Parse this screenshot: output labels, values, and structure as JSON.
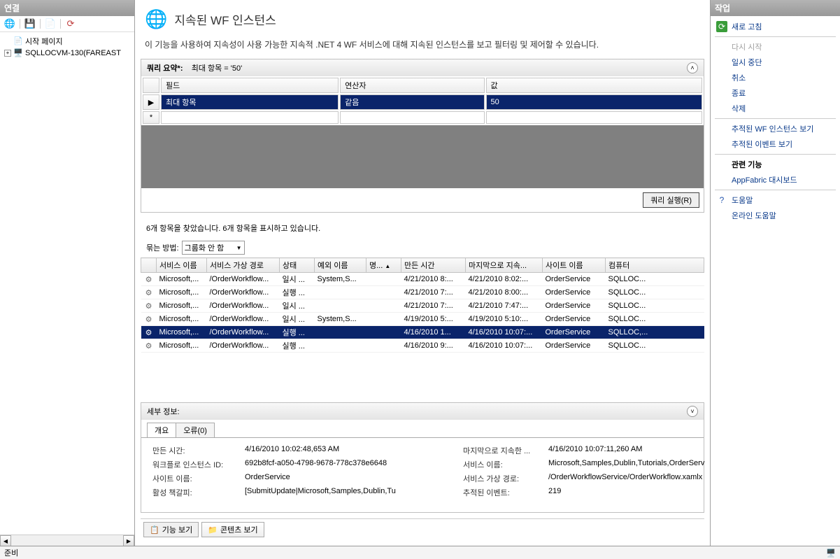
{
  "left": {
    "header": "연결",
    "tree": {
      "start_page": "시작 페이지",
      "server": "SQLLOCVM-130(FAREAST"
    }
  },
  "center": {
    "title": "지속된 WF 인스턴스",
    "description": "이 기능을 사용하여 지속성이 사용 가능한 지속적 .NET 4 WF 서비스에 대해 지속된 인스턴스를 보고 필터링 및 제어할 수 있습니다.",
    "query": {
      "summary_label": "쿼리 요약*:",
      "summary_value": "최대 항목 = '50'",
      "headers": {
        "field": "필드",
        "operator": "연산자",
        "value": "값"
      },
      "row": {
        "field": "최대 항목",
        "operator": "같음",
        "value": "50"
      },
      "star": "*",
      "run_button": "쿼리 실행(R)"
    },
    "results": {
      "status": "6개 항목을 찾았습니다. 6개 항목을 표시하고 있습니다.",
      "group_label": "묶는 방법:",
      "group_value": "그룹화 안 함",
      "headers": {
        "service_name": "서비스 이름",
        "service_path": "서비스 가상 경로",
        "status": "상태",
        "exception": "예외 이름",
        "name": "명...",
        "created": "만든 시간",
        "last_persisted": "마지막으로 지속...",
        "site": "사이트 이름",
        "computer": "컴퓨터"
      },
      "rows": [
        {
          "service": "Microsoft,...",
          "path": "/OrderWorkflow...",
          "status": "일시 ...",
          "exception": "System,S...",
          "name": "",
          "created": "4/21/2010 8:...",
          "last": "4/21/2010 8:02:...",
          "site": "OrderService",
          "computer": "SQLLOC..."
        },
        {
          "service": "Microsoft,...",
          "path": "/OrderWorkflow...",
          "status": "실행 ...",
          "exception": "",
          "name": "",
          "created": "4/21/2010 7:...",
          "last": "4/21/2010 8:00:...",
          "site": "OrderService",
          "computer": "SQLLOC..."
        },
        {
          "service": "Microsoft,...",
          "path": "/OrderWorkflow...",
          "status": "일시 ...",
          "exception": "",
          "name": "",
          "created": "4/21/2010 7:...",
          "last": "4/21/2010 7:47:...",
          "site": "OrderService",
          "computer": "SQLLOC..."
        },
        {
          "service": "Microsoft,...",
          "path": "/OrderWorkflow...",
          "status": "일시 ...",
          "exception": "System,S...",
          "name": "",
          "created": "4/19/2010 5:...",
          "last": "4/19/2010 5:10:...",
          "site": "OrderService",
          "computer": "SQLLOC..."
        },
        {
          "service": "Microsoft,...",
          "path": "/OrderWorkflow...",
          "status": "실행 ...",
          "exception": "",
          "name": "",
          "created": "4/16/2010 1...",
          "last": "4/16/2010 10:07:...",
          "site": "OrderService",
          "computer": "SQLLOC,...",
          "selected": true
        },
        {
          "service": "Microsoft,...",
          "path": "/OrderWorkflow...",
          "status": "실행 ...",
          "exception": "",
          "name": "",
          "created": "4/16/2010 9:...",
          "last": "4/16/2010 10:07:...",
          "site": "OrderService",
          "computer": "SQLLOC..."
        }
      ]
    },
    "details": {
      "header": "세부 정보:",
      "tabs": {
        "overview": "개요",
        "errors": "오류(0)"
      },
      "fields": {
        "created_label": "만든 시간:",
        "created_value": "4/16/2010 10:02:48,653 AM",
        "wf_id_label": "워크플로 인스턴스 ID:",
        "wf_id_value": "692b8fcf-a050-4798-9678-778c378e6648",
        "site_label": "사이트 이름:",
        "site_value": "OrderService",
        "bookmark_label": "활성 책갈피:",
        "bookmark_value": "[SubmitUpdate|Microsoft,Samples,Dublin,Tu",
        "last_label": "마지막으로 지속한 ...",
        "last_value": "4/16/2010 10:07:11,260 AM",
        "service_name_label": "서비스 이름:",
        "service_name_value": "Microsoft,Samples,Dublin,Tutorials,OrderServ",
        "service_path_label": "서비스 가상 경로:",
        "service_path_value": "/OrderWorkflowService/OrderWorkflow.xamlx",
        "tracked_label": "추적된 이벤트:",
        "tracked_value": "219"
      }
    },
    "bottom_tabs": {
      "features": "기능 보기",
      "content": "콘텐츠 보기"
    }
  },
  "right": {
    "header": "작업",
    "items": {
      "refresh": "새로 고침",
      "restart": "다시 시작",
      "suspend": "일시 중단",
      "cancel": "취소",
      "terminate": "종료",
      "delete": "삭제",
      "view_tracked_wf": "추적된 WF 인스턴스 보기",
      "view_tracked_events": "추적된 이벤트 보기",
      "related": "관련 기능",
      "appfabric": "AppFabric 대시보드",
      "help": "도움말",
      "online_help": "온라인 도움말"
    }
  },
  "status_bar": "준비"
}
